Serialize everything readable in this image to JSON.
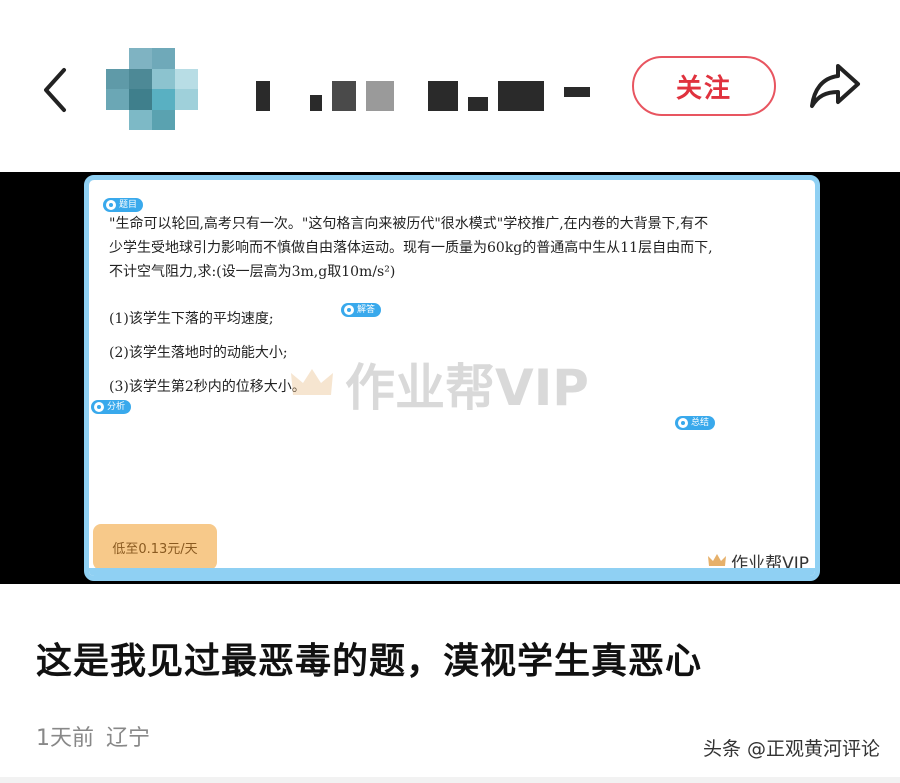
{
  "header": {
    "follow_label": "关注",
    "back_icon": "chevron-left-icon",
    "share_icon": "share-arrow-icon"
  },
  "card": {
    "tag_question": "题目",
    "tag_answer": "解答",
    "tag_analysis": "分析",
    "tag_summary": "总结",
    "question_lines": [
      "\"生命可以轮回,高考只有一次。\"这句格言向来被历代\"很水模式\"学校推广,在内卷的大背景下,有不",
      "少学生受地球引力影响而不慎做自由落体运动。现有一质量为60kg的普通高中生从11层自由而下,",
      "不计空气阻力,求:(设一层高为3m,g取10m/s²)"
    ],
    "sub_questions": [
      "(1)该学生下落的平均速度;",
      "(2)该学生落地时的动能大小;",
      "(3)该学生第2秒内的位移大小。"
    ],
    "watermark": "作业帮VIP",
    "price_button": "低至0.13元/天",
    "brand": "作业帮VIP"
  },
  "post": {
    "title": "这是我见过最恶毒的题，漠视学生真恶心",
    "time": "1天前",
    "location": "辽宁",
    "credit": "头条 @正观黄河评论"
  },
  "colors": {
    "accent_red": "#e0323e",
    "card_border": "#8fd0f3",
    "tag_blue": "#39a9ec",
    "price_bg": "#f7c98a"
  }
}
